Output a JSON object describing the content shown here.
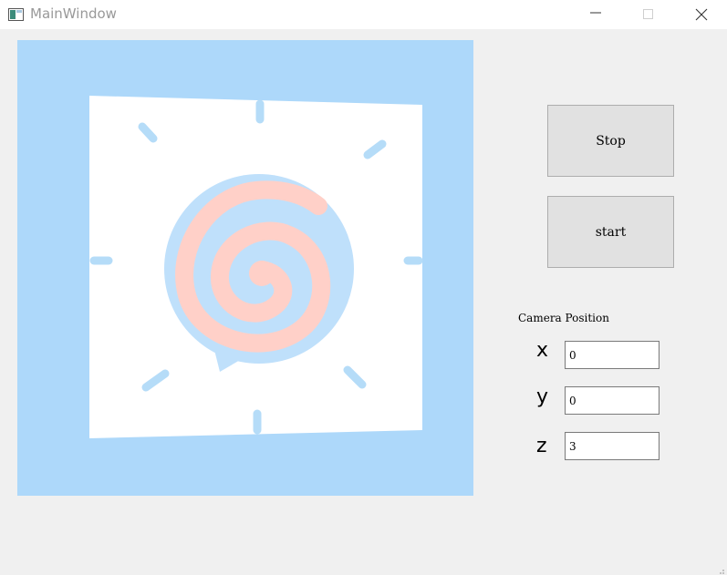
{
  "window": {
    "title": "MainWindow",
    "controls": [
      "minimize-icon",
      "maximize-icon",
      "close-icon"
    ]
  },
  "viewport": {
    "background_color": "#add8fa",
    "card_color": "#ffffff",
    "ray_color": "#b5dcf8",
    "bubble_color": "#bfe0fb",
    "spiral_color": "#ffd0c8"
  },
  "controls": {
    "stop_label": "Stop",
    "start_label": "start"
  },
  "camera": {
    "group_label": "Camera Position",
    "x_label": "x",
    "y_label": "y",
    "z_label": "z",
    "x_value": "0",
    "y_value": "0",
    "z_value": "3"
  }
}
